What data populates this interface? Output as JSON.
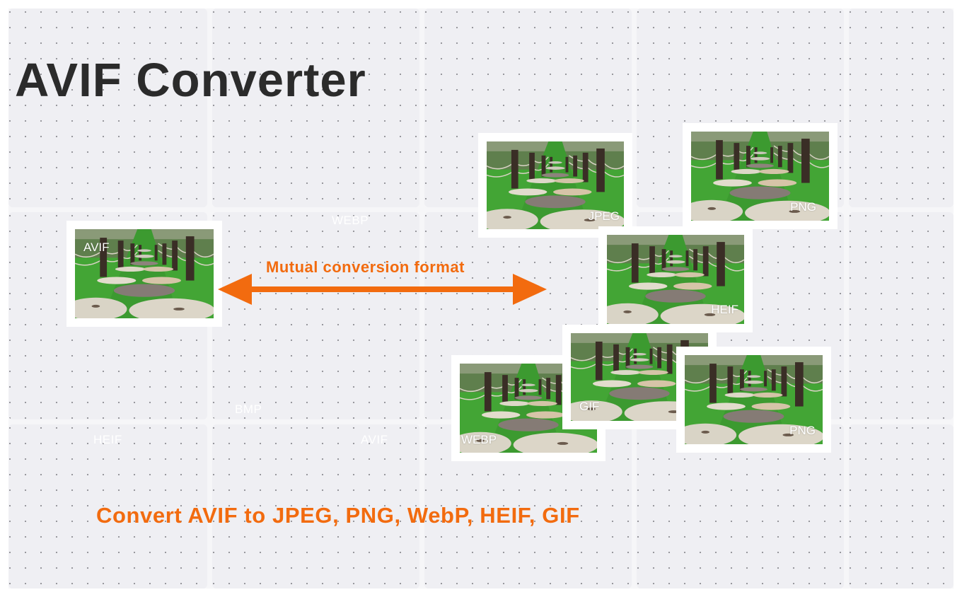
{
  "title": "AVIF Converter",
  "arrow_label": "Mutual conversion format",
  "subtitle": "Convert AVIF to JPEG, PNG, WebP, HEIF, GIF",
  "accent_color": "#f26b0f",
  "background_watermarks": [
    "WEBP",
    "BMP",
    "HEIF",
    "AVIF"
  ],
  "source_image": {
    "format_label": "AVIF",
    "icon": "photo-stone-path"
  },
  "target_images": [
    {
      "format_label": "JPEG",
      "icon": "photo-stone-path"
    },
    {
      "format_label": "PNG",
      "icon": "photo-stone-path"
    },
    {
      "format_label": "HEIF",
      "icon": "photo-stone-path"
    },
    {
      "format_label": "WEBP",
      "icon": "photo-stone-path"
    },
    {
      "format_label": "GIF",
      "icon": "photo-stone-path"
    },
    {
      "format_label": "PNG",
      "icon": "photo-stone-path"
    }
  ]
}
